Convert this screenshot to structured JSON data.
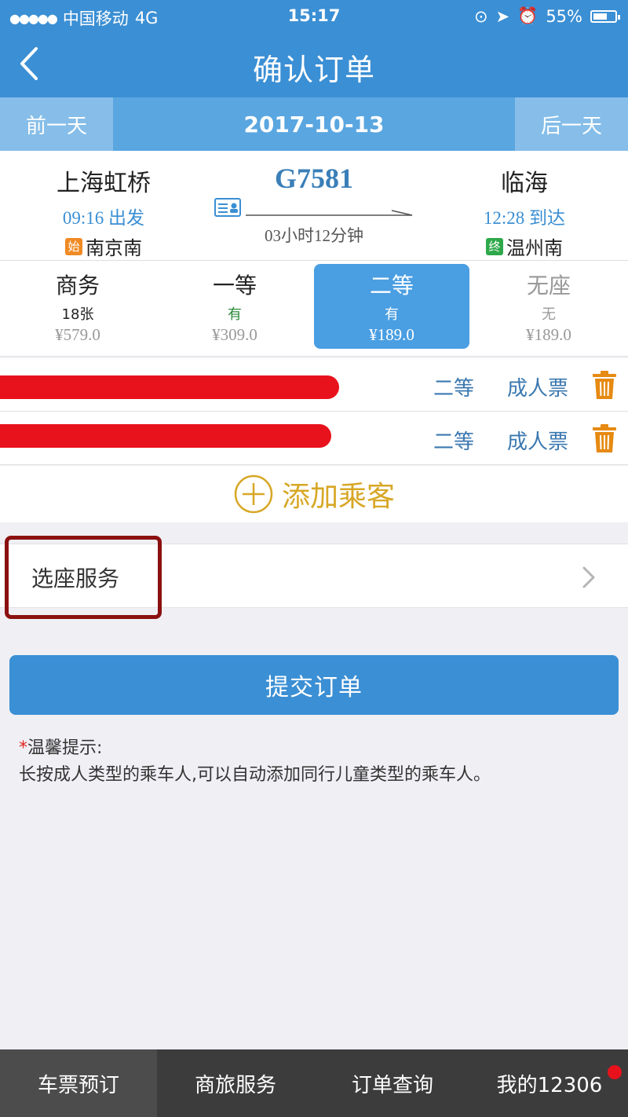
{
  "status_bar": {
    "carrier": "中国移动",
    "network": "4G",
    "time": "15:17",
    "battery": "55%"
  },
  "nav": {
    "title": "确认订单"
  },
  "date_bar": {
    "prev_label": "前一天",
    "date": "2017-10-13",
    "next_label": "后一天"
  },
  "train": {
    "from_station": "上海虹桥",
    "depart_time": "09:16 出发",
    "start_tag": "始",
    "start_station": "南京南",
    "train_number": "G7581",
    "duration": "03小时12分钟",
    "to_station": "临海",
    "arrive_time": "12:28 到达",
    "terminal_tag": "终",
    "terminal_station": "温州南"
  },
  "seats": [
    {
      "class": "商务",
      "availability": "18张",
      "price": "¥579.0"
    },
    {
      "class": "一等",
      "availability": "有",
      "price": "¥309.0"
    },
    {
      "class": "二等",
      "availability": "有",
      "price": "¥189.0"
    },
    {
      "class": "无座",
      "availability": "无",
      "price": "¥189.0"
    }
  ],
  "selected_seat": "二等",
  "passengers": [
    {
      "seat_class": "二等",
      "ticket_type": "成人票"
    },
    {
      "seat_class": "二等",
      "ticket_type": "成人票"
    }
  ],
  "add_passenger_label": "添加乘客",
  "seat_service_label": "选座服务",
  "submit_label": "提交订单",
  "tip": {
    "title": "温馨提示:",
    "text": "长按成人类型的乘车人,可以自动添加同行儿童类型的乘车人。"
  },
  "tabs": [
    {
      "label": "车票预订",
      "active": true
    },
    {
      "label": "商旅服务",
      "active": false
    },
    {
      "label": "订单查询",
      "active": false
    },
    {
      "label": "我的12306",
      "active": false
    }
  ],
  "colors": {
    "primary": "#3b8fd4",
    "accent_gold": "#d7a726",
    "highlight_border": "#8b1010",
    "redaction": "#e8121c"
  }
}
